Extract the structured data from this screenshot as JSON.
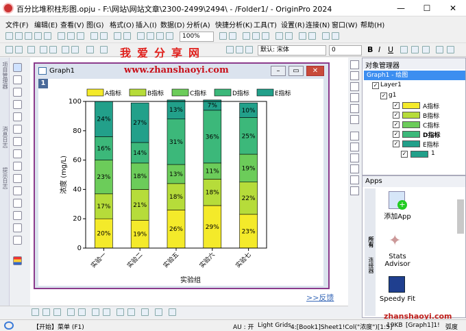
{
  "window": {
    "title": "百分比堆积柱形图.opju - F:\\网站\\网站文章\\2300-2499\\2494\\ - /Folder1/ - OriginPro 2024",
    "min": "—",
    "max": "☐",
    "close": "✕"
  },
  "menu": [
    "文件(F)",
    "编辑(E)",
    "查看(V)",
    "图(G)",
    "格式(O)",
    "插入(I)",
    "数据(D)",
    "分析(A)",
    "快捷分析(K)",
    "工具(T)",
    "设置(R)",
    "连接(N)",
    "窗口(W)",
    "帮助(H)"
  ],
  "toolbar": {
    "zoom": "100%",
    "font": "默认: 宋体",
    "size": "0",
    "bold": "B",
    "italic": "I",
    "underline": "U"
  },
  "watermark": {
    "top_text": "我爱分享网",
    "url": "www.zhanshaoyi.com",
    "bottom": "zhanshaoyi.com"
  },
  "left_tabs": [
    "项目管理器",
    "消息日志",
    "提示日志"
  ],
  "graph_window": {
    "title": "Graph1",
    "layer": "1"
  },
  "feedback": ">>反馈",
  "object_manager": {
    "title": "对象管理器",
    "graph": "Graph1 - 绘图",
    "layer": "Layer1",
    "group": "g1",
    "items": [
      {
        "label": "A指标",
        "color": "#f4ea2a"
      },
      {
        "label": "B指标",
        "color": "#b6dc3a"
      },
      {
        "label": "C指标",
        "color": "#6ccc5a"
      },
      {
        "label": "D指标",
        "color": "#3cb87a"
      },
      {
        "label": "E指标",
        "color": "#22a08a"
      }
    ],
    "sub": "1"
  },
  "apps": {
    "title": "Apps",
    "tab_all": "所有",
    "tab_conn": "连接器",
    "items": [
      "添加App",
      "Stats Advisor",
      "Speedy Fit"
    ]
  },
  "status": {
    "start": "【开始】菜单 (F1)",
    "au": "AU : 开",
    "grid": "Light Grids",
    "ref": "4:[Book1]Sheet1!Col(\"浓度\")[1:5]",
    "size": "19KB",
    "graph": "[Graph1]1!",
    "angle": "弧度"
  },
  "chart_data": {
    "type": "bar",
    "stacked": true,
    "categories": [
      "实验一",
      "实验二",
      "实验五",
      "实验六",
      "实验七"
    ],
    "series": [
      {
        "name": "A指标",
        "values": [
          20,
          19,
          26,
          29,
          23
        ],
        "labels": [
          "20%",
          "19%",
          "26%",
          "29%",
          "23%"
        ]
      },
      {
        "name": "B指标",
        "values": [
          17,
          21,
          18,
          18,
          22
        ],
        "labels": [
          "17%",
          "21%",
          "18%",
          "18%",
          "22%"
        ]
      },
      {
        "name": "C指标",
        "values": [
          23,
          18,
          13,
          11,
          19
        ],
        "labels": [
          "23%",
          "18%",
          "13%",
          "11%",
          "19%"
        ]
      },
      {
        "name": "D指标",
        "values": [
          16,
          14,
          31,
          36,
          25
        ],
        "labels": [
          "16%",
          "14%",
          "31%",
          "36%",
          "25%"
        ]
      },
      {
        "name": "E指标",
        "values": [
          24,
          27,
          13,
          7,
          10
        ],
        "labels": [
          "24%",
          "27%",
          "13%",
          "7%",
          "10%"
        ]
      }
    ],
    "colors": [
      "#f4ea2a",
      "#b6dc3a",
      "#6ccc5a",
      "#3cb87a",
      "#22a08a"
    ],
    "xlabel": "实验组",
    "ylabel": "浓度 (mg/L)",
    "ylim": [
      0,
      100
    ],
    "yticks": [
      0,
      20,
      40,
      60,
      80,
      100
    ],
    "legend": "top"
  }
}
